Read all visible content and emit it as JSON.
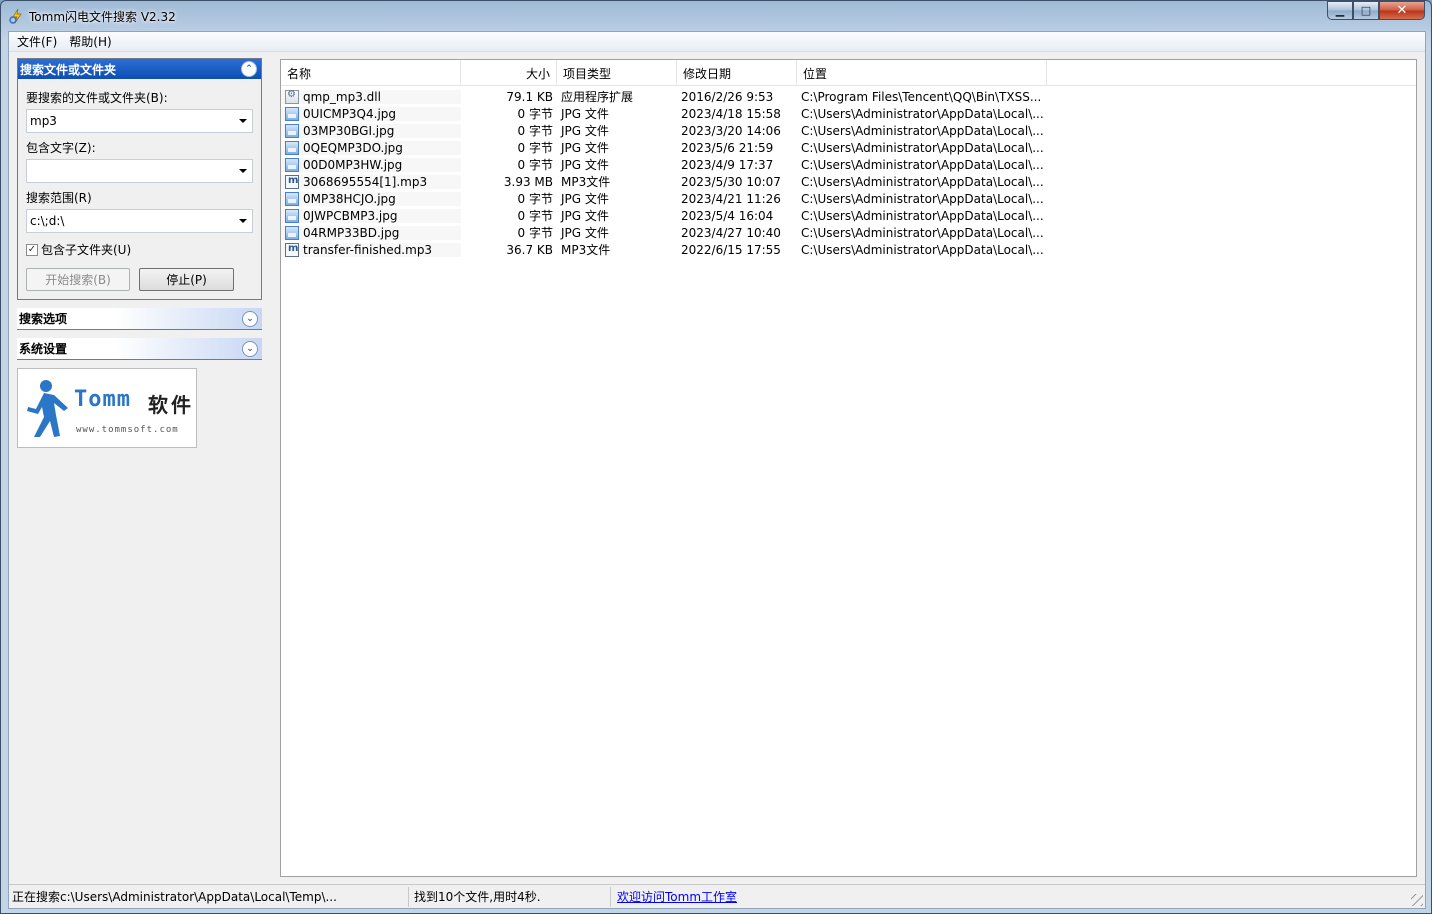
{
  "window": {
    "title": "Tomm闪电文件搜索 V2.32",
    "minimize": "▁",
    "maximize": "□",
    "close": "✕"
  },
  "menu": [
    {
      "label": "文件(F)"
    },
    {
      "label": "帮助(H)"
    }
  ],
  "search_panel": {
    "header": "搜索文件或文件夹",
    "name_label": "要搜索的文件或文件夹(B):",
    "name_value": "mp3",
    "text_label": "包含文字(Z):",
    "text_value": "",
    "scope_label": "搜索范围(R)",
    "scope_value": "c:\\;d:\\",
    "include_subfolders": {
      "label": "包含子文件夹(U)",
      "checked": true,
      "mark": "✓"
    },
    "start_button": "开始搜索(B)",
    "stop_button": "停止(P)",
    "collapse_glyph": "⌃"
  },
  "sections": [
    {
      "label": "搜索选项",
      "glyph": "⌄"
    },
    {
      "label": "系统设置",
      "glyph": "⌄"
    }
  ],
  "logo": {
    "brand": "Tomm",
    "cn": "软件",
    "url": "www.tommsoft.com",
    "accent": "#2c76c7"
  },
  "columns": [
    "名称",
    "大小",
    "项目类型",
    "修改日期",
    "位置"
  ],
  "rows": [
    {
      "icon": "dll",
      "name": "qmp_mp3.dll",
      "size": "79.1 KB",
      "type": "应用程序扩展",
      "date": "2016/2/26 9:53",
      "path": "C:\\Program Files\\Tencent\\QQ\\Bin\\TXSS..."
    },
    {
      "icon": "jpg",
      "name": "0UICMP3Q4.jpg",
      "size": "0 字节",
      "type": "JPG 文件",
      "date": "2023/4/18 15:58",
      "path": "C:\\Users\\Administrator\\AppData\\Local\\..."
    },
    {
      "icon": "jpg",
      "name": "03MP30BGI.jpg",
      "size": "0 字节",
      "type": "JPG 文件",
      "date": "2023/3/20 14:06",
      "path": "C:\\Users\\Administrator\\AppData\\Local\\..."
    },
    {
      "icon": "jpg",
      "name": "0QEQMP3DO.jpg",
      "size": "0 字节",
      "type": "JPG 文件",
      "date": "2023/5/6 21:59",
      "path": "C:\\Users\\Administrator\\AppData\\Local\\..."
    },
    {
      "icon": "jpg",
      "name": "00D0MP3HW.jpg",
      "size": "0 字节",
      "type": "JPG 文件",
      "date": "2023/4/9 17:37",
      "path": "C:\\Users\\Administrator\\AppData\\Local\\..."
    },
    {
      "icon": "mp3",
      "name": "3068695554[1].mp3",
      "size": "3.93 MB",
      "type": "MP3文件",
      "date": "2023/5/30 10:07",
      "path": "C:\\Users\\Administrator\\AppData\\Local\\..."
    },
    {
      "icon": "jpg",
      "name": "0MP38HCJO.jpg",
      "size": "0 字节",
      "type": "JPG 文件",
      "date": "2023/4/21 11:26",
      "path": "C:\\Users\\Administrator\\AppData\\Local\\..."
    },
    {
      "icon": "jpg",
      "name": "0JWPCBMP3.jpg",
      "size": "0 字节",
      "type": "JPG 文件",
      "date": "2023/5/4 16:04",
      "path": "C:\\Users\\Administrator\\AppData\\Local\\..."
    },
    {
      "icon": "jpg",
      "name": "04RMP33BD.jpg",
      "size": "0 字节",
      "type": "JPG 文件",
      "date": "2023/4/27 10:40",
      "path": "C:\\Users\\Administrator\\AppData\\Local\\..."
    },
    {
      "icon": "mp3",
      "name": "transfer-finished.mp3",
      "size": "36.7 KB",
      "type": "MP3文件",
      "date": "2022/6/15 17:55",
      "path": "C:\\Users\\Administrator\\AppData\\Local\\..."
    }
  ],
  "status": {
    "searching": "正在搜索c:\\Users\\Administrator\\AppData\\Local\\Temp\\...",
    "found": "找到10个文件,用时4秒.",
    "link": "欢迎访问Tomm工作室"
  }
}
